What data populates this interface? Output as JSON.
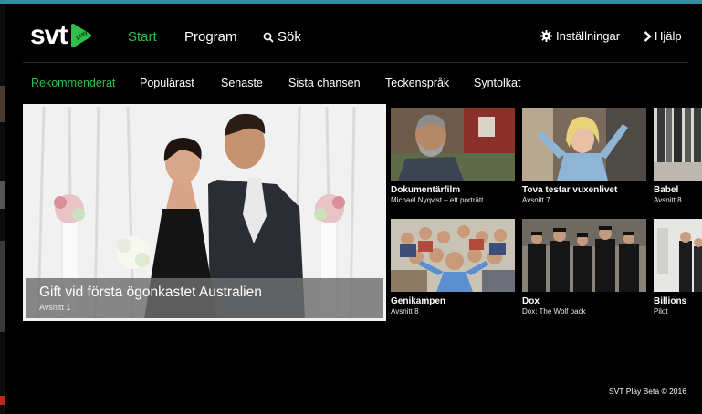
{
  "header": {
    "logo_text": "svt",
    "logo_badge": "play",
    "nav_start": "Start",
    "nav_program": "Program",
    "nav_search": "Sök",
    "nav_settings": "Inställningar",
    "nav_help": "Hjälp"
  },
  "subnav": {
    "items": [
      "Rekommenderat",
      "Populärast",
      "Senaste",
      "Sista chansen",
      "Teckenspråk",
      "Syntolkat"
    ],
    "active_index": 0
  },
  "hero": {
    "title": "Gift vid första ögonkastet Australien",
    "subtitle": "Avsnitt 1"
  },
  "tiles": [
    {
      "title": "Dokumentärfilm",
      "subtitle": "Michael Nyqvist – ett porträtt"
    },
    {
      "title": "Tova testar vuxenlivet",
      "subtitle": "Avsnitt 7"
    },
    {
      "title": "Babel",
      "subtitle": "Avsnitt 8"
    },
    {
      "title": "Genikampen",
      "subtitle": "Avsnitt 8"
    },
    {
      "title": "Dox",
      "subtitle": "Dox: The Wolf pack"
    },
    {
      "title": "Billions",
      "subtitle": "Pilot"
    }
  ],
  "footer": {
    "copyright": "SVT Play Beta © 2016"
  },
  "colors": {
    "accent_green": "#2fbf4a",
    "background": "#000000",
    "top_stripe": "#2f8fa3"
  },
  "icons": [
    "search-icon",
    "gear-icon",
    "chevron-right-icon",
    "play-badge-icon"
  ]
}
